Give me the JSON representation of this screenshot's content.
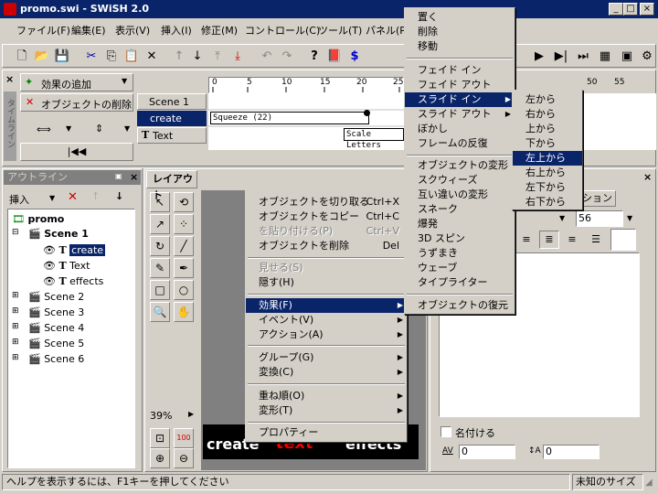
{
  "window": {
    "title": "promo.swi - SWiSH 2.0"
  },
  "menubar": [
    "ファイル(F)",
    "編集(E)",
    "表示(V)",
    "挿入(I)",
    "修正(M)",
    "コントロール(C)",
    "ツール(T)",
    "パネル(P)"
  ],
  "timeline": {
    "add_effect": "効果の追加",
    "delete_object": "オブジェクトの削除",
    "rows": [
      "Scene 1",
      "create",
      "Text"
    ],
    "squeeze": "Squeeze (22)",
    "scale_letters": "Scale Letters",
    "ruler": [
      "0",
      "5",
      "10",
      "15",
      "20",
      "25",
      "50",
      "55"
    ],
    "vertical_label": "タイムライン"
  },
  "outline": {
    "title": "アウトライン",
    "insert": "挿入",
    "items": [
      "promo",
      "Scene 1",
      "create",
      "Text",
      "effects",
      "Scene 2",
      "Scene 3",
      "Scene 4",
      "Scene 5",
      "Scene 6"
    ]
  },
  "layout": {
    "title": "レイアウト",
    "zoom": "39%",
    "stage_text": "create",
    "stage_text2": "text",
    "stage_text3": "effects"
  },
  "context_menu": {
    "items": [
      "オブジェクトを切り取る",
      "オブジェクトをコピー",
      "を貼り付ける(P)",
      "オブジェクトを削除",
      "見せる(S)",
      "隠す(H)",
      "効果(F)",
      "イベント(V)",
      "アクション(A)",
      "グループ(G)",
      "変換(C)",
      "重ね順(O)",
      "変形(T)",
      "プロパティー"
    ],
    "shortcuts": [
      "Ctrl+X",
      "Ctrl+C",
      "Ctrl+V",
      "Del"
    ]
  },
  "effects_menu": {
    "items": [
      "置く",
      "削除",
      "移動",
      "フェイド イン",
      "フェイド アウト",
      "スライド イン",
      "スライド アウト",
      "ぼかし",
      "フレームの反復",
      "オブジェクトの変形",
      "スクウィーズ",
      "互い違いの変形",
      "スネーク",
      "爆発",
      "3D スピン",
      "うずまき",
      "ウェーブ",
      "タイプライター",
      "オブジェクトの復元"
    ]
  },
  "slide_menu": {
    "items": [
      "左から",
      "右から",
      "上から",
      "下から",
      "左上から",
      "右上から",
      "左下から",
      "右下から"
    ]
  },
  "properties": {
    "tab": "ション",
    "font_size": "56",
    "name_label": "名付ける",
    "av_value": "0",
    "aa_value": "0"
  },
  "status": {
    "help": "ヘルプを表示するには、F1キーを押してください",
    "size": "未知のサイズ"
  }
}
